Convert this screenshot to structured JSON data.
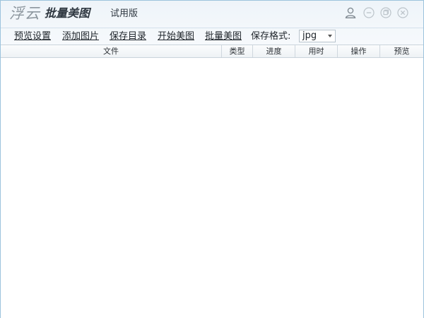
{
  "titlebar": {
    "brand": "浮云",
    "app_name": "批量美图",
    "edition": "试用版"
  },
  "toolbar": {
    "preview_settings": "预览设置",
    "add_images": "添加图片",
    "save_directory": "保存目录",
    "start_beautify": "开始美图",
    "batch_beautify": "批量美图",
    "save_format_label": "保存格式:",
    "save_format_value": "jpg"
  },
  "table": {
    "columns": [
      "文件",
      "类型",
      "进度",
      "用时",
      "操作",
      "预览"
    ],
    "rows": []
  },
  "icons": {
    "user": "user-icon",
    "minimize": "minimize-icon",
    "maximize": "restore-icon",
    "close": "close-icon"
  },
  "colors": {
    "border": "#9cc3dd",
    "icon": "#b8c0c6"
  }
}
